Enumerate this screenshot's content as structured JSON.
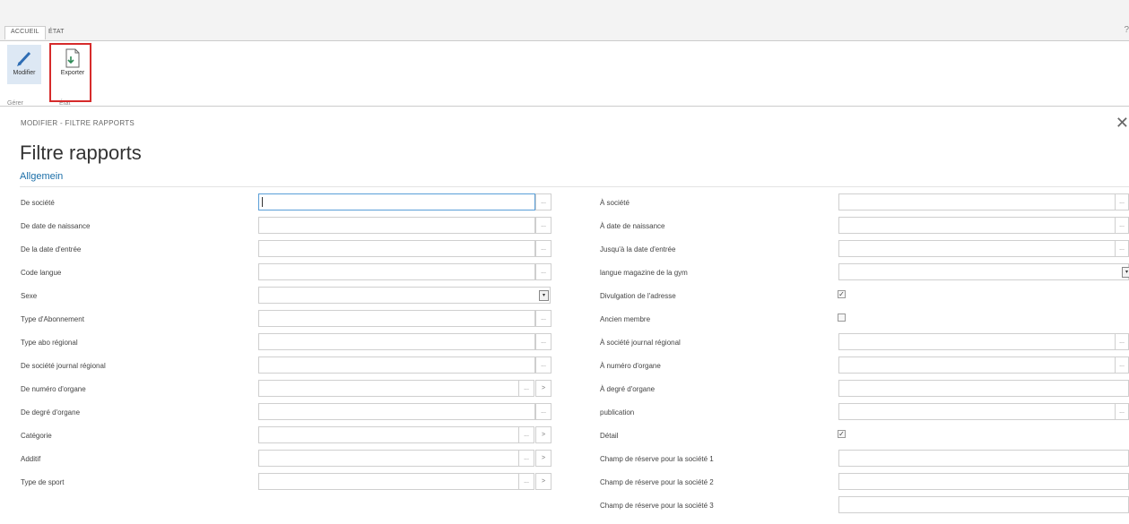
{
  "tabs": {
    "home": "ACCUEIL",
    "state": "ÉTAT"
  },
  "ribbon": {
    "modifier_label": "Modifier",
    "export_label": "Exporter",
    "group_manage": "Gérer",
    "group_state": "État"
  },
  "breadcrumb": "MODIFIER - FILTRE RAPPORTS",
  "page_title": "Filtre rapports",
  "section_title": "Allgemein",
  "left_fields": [
    {
      "label": "De société"
    },
    {
      "label": "De date de naissance"
    },
    {
      "label": "De la date d'entrée"
    },
    {
      "label": "Code langue"
    },
    {
      "label": "Sexe"
    },
    {
      "label": "Type d'Abonnement"
    },
    {
      "label": "Type abo régional"
    },
    {
      "label": "De société journal régional"
    },
    {
      "label": "De numéro d'organe"
    },
    {
      "label": "De degré d'organe"
    },
    {
      "label": "Catégorie"
    },
    {
      "label": "Additif"
    },
    {
      "label": "Type de sport"
    }
  ],
  "right_fields": [
    {
      "label": "À société"
    },
    {
      "label": "À date de naissance"
    },
    {
      "label": "Jusqu'à la date d'entrée"
    },
    {
      "label": "langue magazine de la gym"
    },
    {
      "label": "Divulgation de l'adresse",
      "checked": true
    },
    {
      "label": "Ancien membre",
      "checked": false
    },
    {
      "label": "À société journal régional"
    },
    {
      "label": "À numéro d'organe"
    },
    {
      "label": "À degré d'organe"
    },
    {
      "label": "publication"
    },
    {
      "label": "Détail",
      "checked": true
    },
    {
      "label": "Champ de réserve pour la société 1"
    },
    {
      "label": "Champ de réserve pour la société 2"
    },
    {
      "label": "Champ de réserve pour la société 3"
    }
  ],
  "glyphs": {
    "lookup": "...",
    "next": ">",
    "dropdown": "▾",
    "check": "✓",
    "close": "✕",
    "help": "?"
  }
}
